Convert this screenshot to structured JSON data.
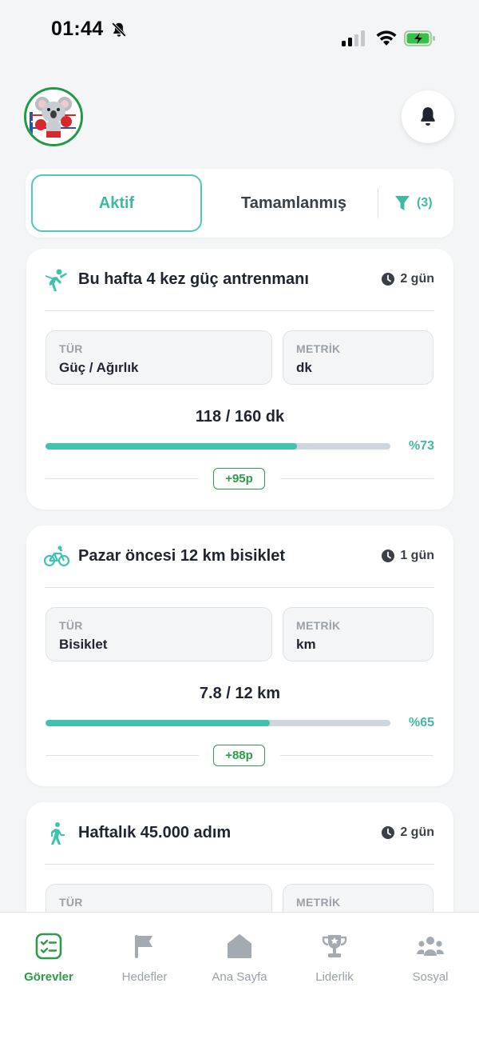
{
  "status_bar": {
    "time": "01:44"
  },
  "tabs": {
    "active_label": "Aktif",
    "completed_label": "Tamamlanmış",
    "filter_count": "(3)"
  },
  "goals": [
    {
      "icon": "strength-icon",
      "title": "Bu hafta 4 kez güç antrenmanı",
      "time_left": "2 gün",
      "type_label": "TÜR",
      "type_value": "Güç / Ağırlık",
      "metric_label": "METRİK",
      "metric_value": "dk",
      "progress_text": "118 / 160 dk",
      "progress_fraction": 0.73,
      "progress_percent": "%73",
      "points": "+95p"
    },
    {
      "icon": "bicycle-icon",
      "title": "Pazar öncesi 12 km bisiklet",
      "time_left": "1 gün",
      "type_label": "TÜR",
      "type_value": "Bisiklet",
      "metric_label": "METRİK",
      "metric_value": "km",
      "progress_text": "7.8 / 12 km",
      "progress_fraction": 0.65,
      "progress_percent": "%65",
      "points": "+88p"
    },
    {
      "icon": "walking-icon",
      "title": "Haftalık 45.000 adım",
      "time_left": "2 gün",
      "type_label": "TÜR",
      "metric_label": "METRİK"
    }
  ],
  "bottom_nav": [
    {
      "label": "Görevler",
      "icon": "tasks-icon",
      "active": true
    },
    {
      "label": "Hedefler",
      "icon": "flag-icon",
      "active": false
    },
    {
      "label": "Ana Sayfa",
      "icon": "home-icon",
      "active": false
    },
    {
      "label": "Liderlik",
      "icon": "trophy-icon",
      "active": false
    },
    {
      "label": "Sosyal",
      "icon": "social-icon",
      "active": false
    }
  ],
  "colors": {
    "accent": "#41c2ae",
    "points_green": "#2e9a4a",
    "background": "#f4f5f6"
  }
}
